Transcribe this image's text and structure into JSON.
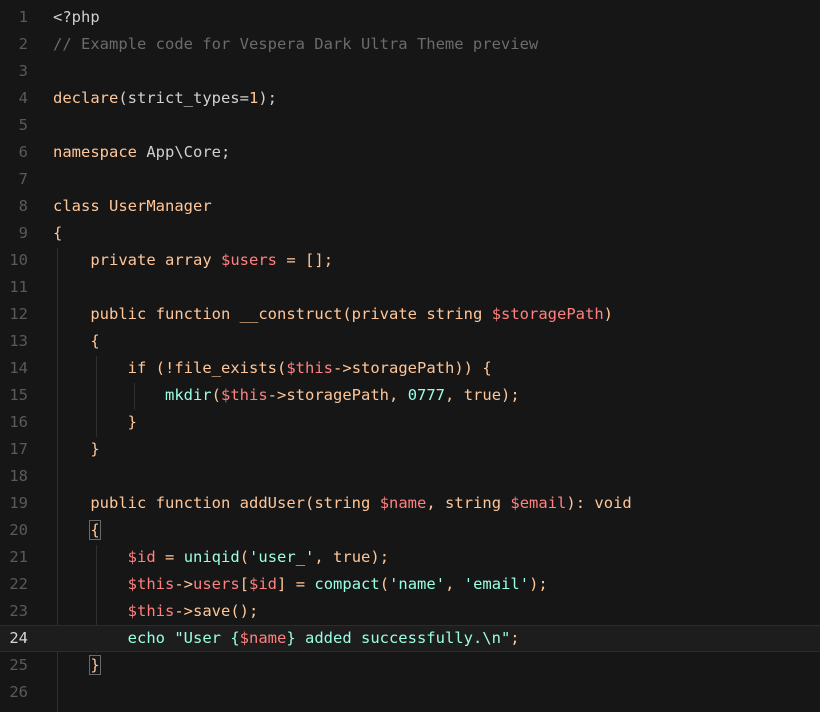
{
  "editor": {
    "theme": "Vespera Dark Ultra",
    "active_line": 24,
    "colors": {
      "background": "#161616",
      "keyword": "#ffc799",
      "variable": "#ff8080",
      "string": "#99ffe4",
      "comment": "#6b6b6b",
      "line_number": "#5a5a5a"
    }
  },
  "lines": [
    {
      "n": 1,
      "tokens": [
        [
          "pl",
          "<?php"
        ]
      ]
    },
    {
      "n": 2,
      "tokens": [
        [
          "cm",
          "// Example code for Vespera Dark Ultra Theme preview"
        ]
      ]
    },
    {
      "n": 3,
      "tokens": []
    },
    {
      "n": 4,
      "tokens": [
        [
          "kw",
          "declare"
        ],
        [
          "pl",
          "(strict_types="
        ],
        [
          "num",
          "1"
        ],
        [
          "pl",
          ");"
        ]
      ]
    },
    {
      "n": 5,
      "tokens": []
    },
    {
      "n": 6,
      "tokens": [
        [
          "kw",
          "namespace"
        ],
        [
          "pl",
          " App\\Core;"
        ]
      ]
    },
    {
      "n": 7,
      "tokens": []
    },
    {
      "n": 8,
      "tokens": [
        [
          "kw",
          "class"
        ],
        [
          "pl",
          " "
        ],
        [
          "fn",
          "UserManager"
        ]
      ]
    },
    {
      "n": 9,
      "tokens": [
        [
          "pn",
          "{"
        ]
      ]
    },
    {
      "n": 10,
      "tokens": [
        [
          "pl",
          "    "
        ],
        [
          "kw",
          "private"
        ],
        [
          "pl",
          " "
        ],
        [
          "kw",
          "array"
        ],
        [
          "pl",
          " "
        ],
        [
          "var",
          "$users"
        ],
        [
          "pl",
          " "
        ],
        [
          "pn",
          "="
        ],
        [
          "pl",
          " "
        ],
        [
          "pn",
          "[];"
        ]
      ]
    },
    {
      "n": 11,
      "tokens": []
    },
    {
      "n": 12,
      "tokens": [
        [
          "pl",
          "    "
        ],
        [
          "kw",
          "public"
        ],
        [
          "pl",
          " "
        ],
        [
          "kw",
          "function"
        ],
        [
          "pl",
          " "
        ],
        [
          "fn",
          "__construct"
        ],
        [
          "pn",
          "("
        ],
        [
          "kw",
          "private"
        ],
        [
          "pl",
          " "
        ],
        [
          "kw",
          "string"
        ],
        [
          "pl",
          " "
        ],
        [
          "var",
          "$storagePath"
        ],
        [
          "pn",
          ")"
        ]
      ]
    },
    {
      "n": 13,
      "tokens": [
        [
          "pl",
          "    "
        ],
        [
          "pn",
          "{"
        ]
      ]
    },
    {
      "n": 14,
      "tokens": [
        [
          "pl",
          "        "
        ],
        [
          "kw",
          "if"
        ],
        [
          "pl",
          " "
        ],
        [
          "pn",
          "(!"
        ],
        [
          "fn",
          "file_exists"
        ],
        [
          "pn",
          "("
        ],
        [
          "var",
          "$this"
        ],
        [
          "pn",
          "->"
        ],
        [
          "fn",
          "storagePath"
        ],
        [
          "pn",
          "))"
        ],
        [
          "pl",
          " "
        ],
        [
          "pn",
          "{"
        ]
      ]
    },
    {
      "n": 15,
      "tokens": [
        [
          "pl",
          "            "
        ],
        [
          "str",
          "mkdir"
        ],
        [
          "pn",
          "("
        ],
        [
          "var",
          "$this"
        ],
        [
          "pn",
          "->"
        ],
        [
          "fn",
          "storagePath"
        ],
        [
          "pn",
          ","
        ],
        [
          "pl",
          " "
        ],
        [
          "str",
          "0777"
        ],
        [
          "pn",
          ","
        ],
        [
          "pl",
          " "
        ],
        [
          "kw",
          "true"
        ],
        [
          "pn",
          ");"
        ]
      ]
    },
    {
      "n": 16,
      "tokens": [
        [
          "pl",
          "        "
        ],
        [
          "pn",
          "}"
        ]
      ]
    },
    {
      "n": 17,
      "tokens": [
        [
          "pl",
          "    "
        ],
        [
          "pn",
          "}"
        ]
      ]
    },
    {
      "n": 18,
      "tokens": []
    },
    {
      "n": 19,
      "tokens": [
        [
          "pl",
          "    "
        ],
        [
          "kw",
          "public"
        ],
        [
          "pl",
          " "
        ],
        [
          "kw",
          "function"
        ],
        [
          "pl",
          " "
        ],
        [
          "fn",
          "addUser"
        ],
        [
          "pn",
          "("
        ],
        [
          "kw",
          "string"
        ],
        [
          "pl",
          " "
        ],
        [
          "var",
          "$name"
        ],
        [
          "pn",
          ","
        ],
        [
          "pl",
          " "
        ],
        [
          "kw",
          "string"
        ],
        [
          "pl",
          " "
        ],
        [
          "var",
          "$email"
        ],
        [
          "pn",
          "):"
        ],
        [
          "pl",
          " "
        ],
        [
          "kw",
          "void"
        ]
      ]
    },
    {
      "n": 20,
      "tokens": [
        [
          "pl",
          "    "
        ],
        [
          "pn",
          "{"
        ]
      ]
    },
    {
      "n": 21,
      "tokens": [
        [
          "pl",
          "        "
        ],
        [
          "var",
          "$id"
        ],
        [
          "pl",
          " "
        ],
        [
          "pn",
          "="
        ],
        [
          "pl",
          " "
        ],
        [
          "str",
          "uniqid"
        ],
        [
          "pn",
          "("
        ],
        [
          "str",
          "'user_'"
        ],
        [
          "pn",
          ","
        ],
        [
          "pl",
          " "
        ],
        [
          "kw",
          "true"
        ],
        [
          "pn",
          ");"
        ]
      ]
    },
    {
      "n": 22,
      "tokens": [
        [
          "pl",
          "        "
        ],
        [
          "var",
          "$this"
        ],
        [
          "pn",
          "->"
        ],
        [
          "var",
          "users"
        ],
        [
          "pn",
          "["
        ],
        [
          "var",
          "$id"
        ],
        [
          "pn",
          "]"
        ],
        [
          "pl",
          " "
        ],
        [
          "pn",
          "="
        ],
        [
          "pl",
          " "
        ],
        [
          "str",
          "compact"
        ],
        [
          "pn",
          "("
        ],
        [
          "str",
          "'name'"
        ],
        [
          "pn",
          ","
        ],
        [
          "pl",
          " "
        ],
        [
          "str",
          "'email'"
        ],
        [
          "pn",
          ");"
        ]
      ]
    },
    {
      "n": 23,
      "tokens": [
        [
          "pl",
          "        "
        ],
        [
          "var",
          "$this"
        ],
        [
          "pn",
          "->"
        ],
        [
          "fn",
          "save"
        ],
        [
          "pn",
          "();"
        ]
      ]
    },
    {
      "n": 24,
      "tokens": [
        [
          "pl",
          "        "
        ],
        [
          "str",
          "echo"
        ],
        [
          "pl",
          " "
        ],
        [
          "str",
          "\"User {"
        ],
        [
          "var",
          "$name"
        ],
        [
          "str",
          "} added successfully.\\n\""
        ],
        [
          "pn",
          ";"
        ]
      ]
    },
    {
      "n": 25,
      "tokens": [
        [
          "pl",
          "    "
        ],
        [
          "pn",
          "}"
        ]
      ]
    },
    {
      "n": 26,
      "tokens": []
    }
  ]
}
